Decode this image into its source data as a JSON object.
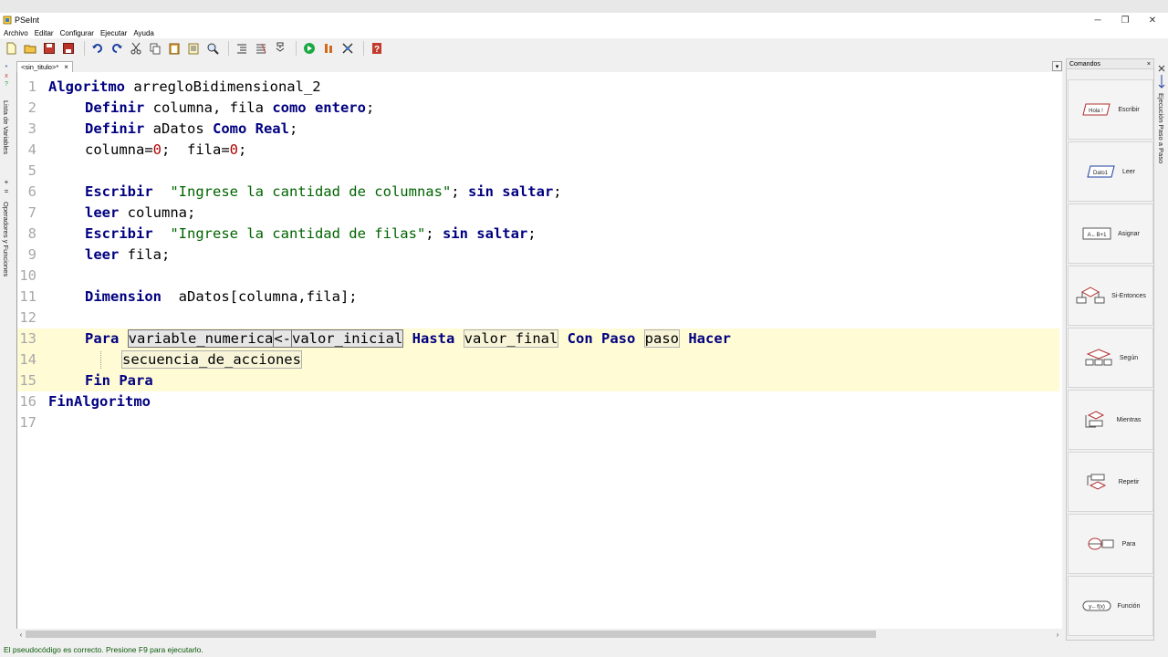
{
  "window": {
    "title": "PSeInt",
    "controls": {
      "minimize": "─",
      "restore": "❐",
      "close": "✕"
    }
  },
  "menubar": {
    "items": [
      "Archivo",
      "Editar",
      "Configurar",
      "Ejecutar",
      "Ayuda"
    ]
  },
  "toolbar": {
    "icons": [
      "new-file-icon",
      "open-folder-icon",
      "save-icon",
      "save-as-icon",
      "undo-icon",
      "redo-icon",
      "cut-icon",
      "copy-icon",
      "paste-icon",
      "copy-text-icon",
      "find-icon",
      "indent-icon",
      "comment-icon",
      "flowchart-icon",
      "run-icon",
      "step-icon",
      "debug-icon",
      "help-icon"
    ]
  },
  "left_panel": {
    "variables_label": "Lista de Variables",
    "operators_label": "Operadores y Funciones"
  },
  "right_panel_label": "Ejecución Paso a Paso",
  "editor": {
    "tab_label": "<sin_titulo>*",
    "tab_close": "×",
    "lines": [
      {
        "n": "1",
        "text": "Algoritmo arregloBidimensional_2"
      },
      {
        "n": "2",
        "text": "Definir columna, fila como entero;"
      },
      {
        "n": "3",
        "text": "Definir aDatos Como Real;"
      },
      {
        "n": "4",
        "text": "columna=0;  fila=0;"
      },
      {
        "n": "5",
        "text": ""
      },
      {
        "n": "6",
        "text": "Escribir  \"Ingrese la cantidad de columnas\"; sin saltar;"
      },
      {
        "n": "7",
        "text": "leer columna;"
      },
      {
        "n": "8",
        "text": "Escribir  \"Ingrese la cantidad de filas\"; sin saltar;"
      },
      {
        "n": "9",
        "text": "leer fila;"
      },
      {
        "n": "10",
        "text": ""
      },
      {
        "n": "11",
        "text": "Dimension  aDatos[columna,fila];"
      },
      {
        "n": "12",
        "text": ""
      },
      {
        "n": "13",
        "text": "Para variable_numerica<-valor_inicial Hasta valor_final Con Paso paso Hacer"
      },
      {
        "n": "14",
        "text": "secuencia_de_acciones"
      },
      {
        "n": "15",
        "text": "Fin Para"
      },
      {
        "n": "16",
        "text": "FinAlgoritmo"
      },
      {
        "n": "17",
        "text": ""
      }
    ],
    "tokens": {
      "l1a": "Algoritmo",
      "l1b": " arregloBidimensional_2",
      "l2a": "Definir",
      "l2b": " columna, fila ",
      "l2c": "como entero",
      "l2d": ";",
      "l3a": "Definir",
      "l3b": " aDatos ",
      "l3c": "Como Real",
      "l3d": ";",
      "l4a": "columna=",
      "l4b": "0",
      "l4c": ";  fila=",
      "l4d": "0",
      "l4e": ";",
      "l6a": "Escribir",
      "l6b": "  ",
      "l6c": "\"Ingrese la cantidad de columnas\"",
      "l6d": "; ",
      "l6e": "sin saltar",
      "l6f": ";",
      "l7a": "leer",
      "l7b": " columna;",
      "l8a": "Escribir",
      "l8b": "  ",
      "l8c": "\"Ingrese la cantidad de filas\"",
      "l8d": "; ",
      "l8e": "sin saltar",
      "l8f": ";",
      "l9a": "leer",
      "l9b": " fila;",
      "l11a": "Dimension",
      "l11b": "  aDatos[columna,fila];",
      "l13a": "Para",
      "l13b": " ",
      "l13c": "variable_numerica",
      "l13d": "<-",
      "l13e": "valor_inicial",
      "l13f": " ",
      "l13g": "Hasta",
      "l13h": " ",
      "l13i": "valor_final",
      "l13j": " ",
      "l13k": "Con Paso",
      "l13l": " ",
      "l13m": "paso",
      "l13n": " ",
      "l13o": "Hacer",
      "l14a": "secuencia_de_acciones",
      "l15a": "Fin Para",
      "l16a": "FinAlgoritmo"
    }
  },
  "status": {
    "message": "El pseudocódigo es correcto. Presione F9 para ejecutarlo."
  },
  "commands_panel": {
    "title": "Comandos",
    "close": "×",
    "items": [
      {
        "label": "Escribir",
        "icon": "write-icon",
        "glyph": "Hola !"
      },
      {
        "label": "Leer",
        "icon": "read-icon",
        "glyph": "Dato1"
      },
      {
        "label": "Asignar",
        "icon": "assign-icon",
        "glyph": "A←B+1"
      },
      {
        "label": "Si-Entonces",
        "icon": "if-then-icon"
      },
      {
        "label": "Según",
        "icon": "switch-icon"
      },
      {
        "label": "Mientras",
        "icon": "while-icon"
      },
      {
        "label": "Repetir",
        "icon": "repeat-icon"
      },
      {
        "label": "Para",
        "icon": "for-icon"
      },
      {
        "label": "Función",
        "icon": "function-icon",
        "glyph": "y←f(x)"
      }
    ]
  },
  "colors": {
    "keyword": "#000080",
    "string": "#006400",
    "number": "#b00000",
    "line_numbers": "#a8a8a8",
    "highlight": "#fffbd4",
    "status_text": "#0a5a0a"
  }
}
